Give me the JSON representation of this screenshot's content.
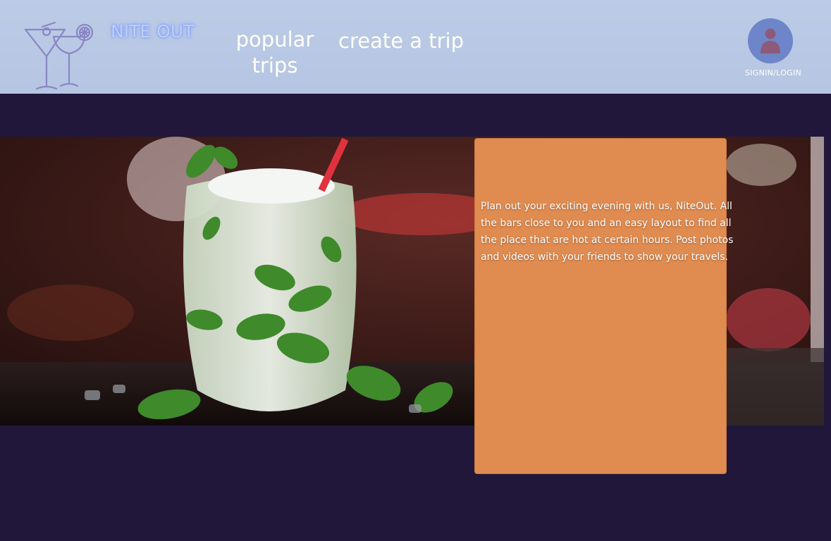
{
  "header": {
    "brand": "NITE OUT",
    "nav": [
      {
        "label": "popular trips"
      },
      {
        "label": "create a trip"
      }
    ],
    "profile": {
      "label": "SIGNIN/LOGIN",
      "icon": "user-icon"
    },
    "logo_icon": "cocktail-glasses-icon"
  },
  "hero": {
    "image": "mojito-cocktail-photo"
  },
  "info_card": {
    "text": "Plan out your exciting evening with us, NiteOut. All the bars close to you and an easy layout to find all the place that are hot at certain hours. Post photos and videos with your friends to show your travels."
  },
  "colors": {
    "header_bg": "#b8c7e4",
    "page_bg": "#20173a",
    "card_bg": "#e08b50",
    "brand_glow": "#7c97ff",
    "avatar_bg": "#6e86c9"
  }
}
